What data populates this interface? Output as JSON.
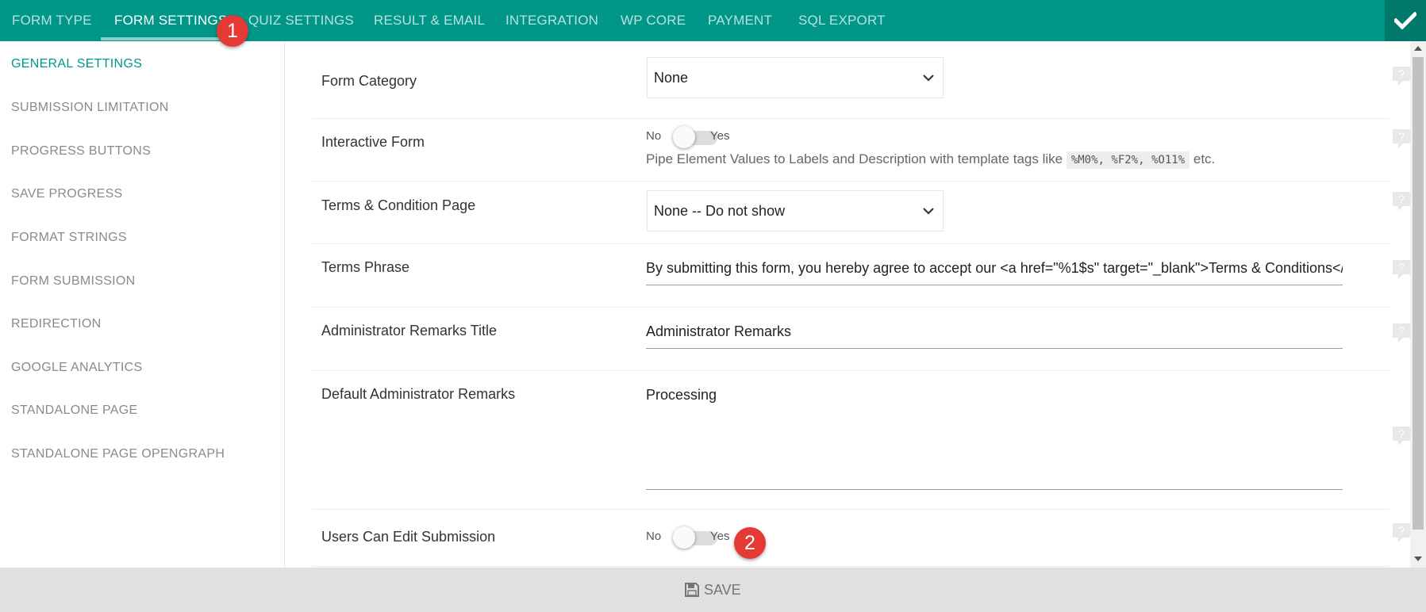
{
  "topnav": {
    "tabs": [
      {
        "label": "FORM TYPE"
      },
      {
        "label": "FORM SETTINGS"
      },
      {
        "label": "QUIZ SETTINGS"
      },
      {
        "label": "RESULT & EMAIL"
      },
      {
        "label": "INTEGRATION"
      },
      {
        "label": "WP CORE"
      },
      {
        "label": "PAYMENT"
      },
      {
        "label": "SQL EXPORT"
      }
    ],
    "active_tab": "FORM SETTINGS",
    "confirm_icon": "check-icon",
    "brand_color": "#009688"
  },
  "badges": [
    "1",
    "2"
  ],
  "sidebar": {
    "items": [
      {
        "label": "GENERAL SETTINGS"
      },
      {
        "label": "SUBMISSION LIMITATION"
      },
      {
        "label": "PROGRESS BUTTONS"
      },
      {
        "label": "SAVE PROGRESS"
      },
      {
        "label": "FORMAT STRINGS"
      },
      {
        "label": "FORM SUBMISSION"
      },
      {
        "label": "REDIRECTION"
      },
      {
        "label": "GOOGLE ANALYTICS"
      },
      {
        "label": "STANDALONE PAGE"
      },
      {
        "label": "STANDALONE PAGE OPENGRAPH"
      }
    ],
    "active_item": "GENERAL SETTINGS"
  },
  "settings": {
    "form_category": {
      "label": "Form Category",
      "value": "None"
    },
    "interactive_form": {
      "label": "Interactive Form",
      "no_label": "No",
      "yes_label": "Yes",
      "enabled": false,
      "desc_prefix": "Pipe Element Values to Labels and Description with template tags like",
      "tags": "%M0%, %F2%, %O11%",
      "desc_suffix": "etc."
    },
    "terms_page": {
      "label": "Terms & Condition Page",
      "value": "None -- Do not show"
    },
    "terms_phrase": {
      "label": "Terms Phrase",
      "value": "By submitting this form, you hereby agree to accept our <a href=\"%1$s\" target=\"_blank\">Terms & Conditions</a>. Y"
    },
    "admin_remarks_title": {
      "label": "Administrator Remarks Title",
      "value": "Administrator Remarks"
    },
    "default_admin_remarks": {
      "label": "Default Administrator Remarks",
      "value": "Processing"
    },
    "users_can_edit": {
      "label": "Users Can Edit Submission",
      "no_label": "No",
      "yes_label": "Yes",
      "enabled": false
    }
  },
  "savebar": {
    "label": "SAVE",
    "icon": "floppy-disk-icon"
  }
}
